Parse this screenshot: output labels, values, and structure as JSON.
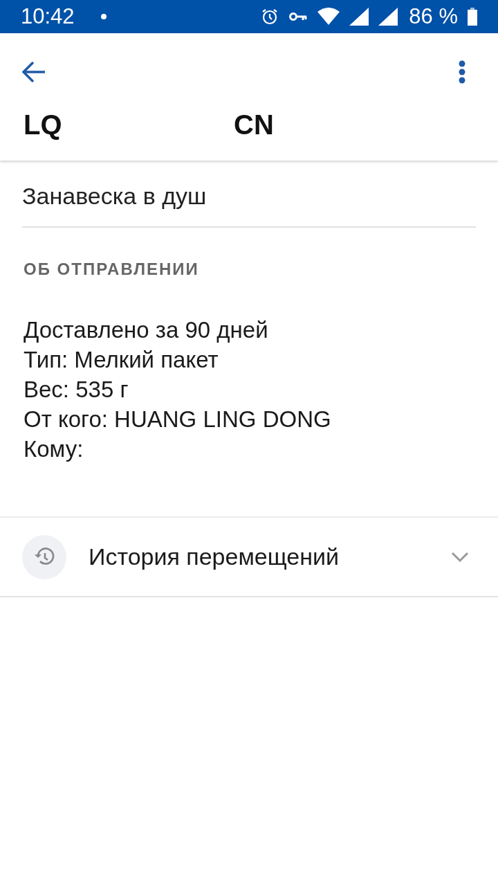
{
  "status_bar": {
    "time": "10:42",
    "battery": "86 %"
  },
  "header": {
    "codes": [
      "LQ",
      "CN"
    ]
  },
  "item_name": "Занавеска в душ",
  "shipment": {
    "heading": "ОБ ОТПРАВЛЕНИИ",
    "lines": [
      "Доставлено за 90 дней",
      "Тип: Мелкий пакет",
      "Вес: 535 г",
      "От кого: HUANG LING DONG",
      "Кому:"
    ]
  },
  "history": {
    "label": "История перемещений",
    "expanded": false
  }
}
